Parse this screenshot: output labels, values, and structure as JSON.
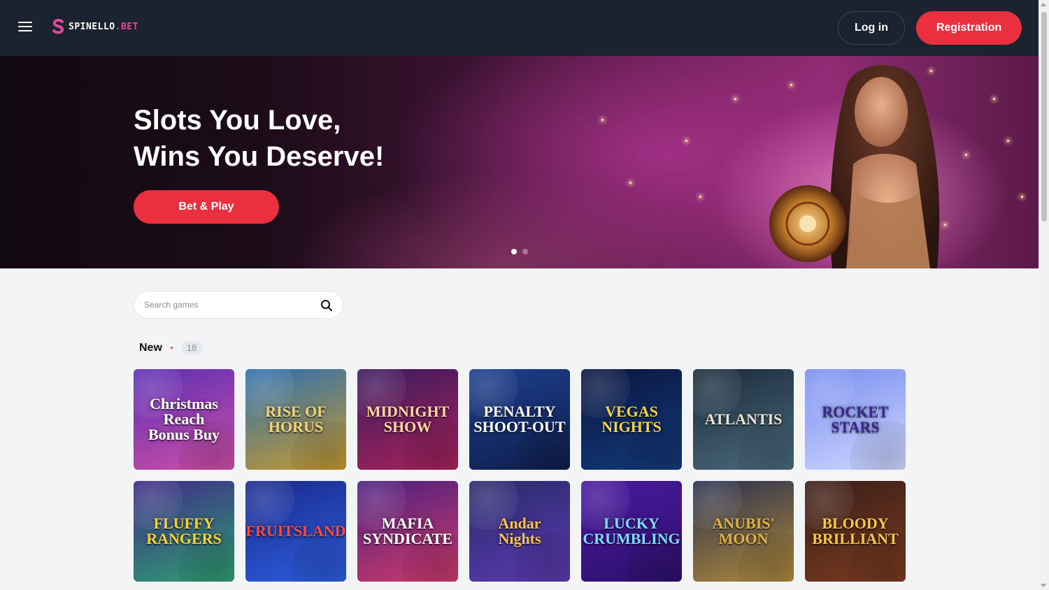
{
  "header": {
    "logo_main": "SPINELLO",
    "logo_suffix": ".BET",
    "login_label": "Log in",
    "register_label": "Registration",
    "menu_icon": "hamburger-menu-icon"
  },
  "hero": {
    "title_line1": "Slots You Love,",
    "title_line2": "Wins You Deserve!",
    "cta_label": "Bet & Play",
    "slides_total": 2,
    "active_slide": 1
  },
  "search": {
    "placeholder": "Search games",
    "icon": "search-icon"
  },
  "section": {
    "title": "New",
    "count": "18"
  },
  "games": [
    {
      "title": "Christmas\nReach\nBonus Buy",
      "colors": [
        "#5a2fb5",
        "#d04fa6"
      ],
      "text": "#ffffff"
    },
    {
      "title": "RISE OF\nHORUS",
      "colors": [
        "#2a6fb0",
        "#c89a2e"
      ],
      "text": "#f3d37a"
    },
    {
      "title": "MIDNIGHT\nSHOW",
      "colors": [
        "#3a1a5e",
        "#a8235a"
      ],
      "text": "#ffd6a0"
    },
    {
      "title": "PENALTY\nSHOOT-OUT",
      "colors": [
        "#1e3f8f",
        "#0d1d4a"
      ],
      "text": "#ffffff"
    },
    {
      "title": "VEGAS\nNIGHTS",
      "colors": [
        "#0a1640",
        "#123a7a"
      ],
      "text": "#f5d24a"
    },
    {
      "title": "ATLANTIS",
      "colors": [
        "#1a2b3a",
        "#4c6a7e"
      ],
      "text": "#e8e2d0"
    },
    {
      "title": "ROCKET\nSTARS",
      "colors": [
        "#7a8ef0",
        "#cfd8ff"
      ],
      "text": "#3a2a90"
    },
    {
      "title": "FLUFFY\nRANGERS",
      "colors": [
        "#3f2a8a",
        "#2f9f6f"
      ],
      "text": "#f7d13c"
    },
    {
      "title": "FRUITSLAND",
      "colors": [
        "#1a2a8a",
        "#2d5de0"
      ],
      "text": "#ff4a3a"
    },
    {
      "title": "MAFIA\nSYNDICATE",
      "colors": [
        "#4a2080",
        "#d03a6a"
      ],
      "text": "#ffffff"
    },
    {
      "title": "Andar\nNights",
      "colors": [
        "#2a2a6a",
        "#5a3ab0"
      ],
      "text": "#f2c14e"
    },
    {
      "title": "LUCKY\nCRUMBLING",
      "colors": [
        "#4a1aa0",
        "#2c0f6a"
      ],
      "text": "#7fd9ff"
    },
    {
      "title": "ANUBIS'\nMOON",
      "colors": [
        "#2a3050",
        "#b08a3a"
      ],
      "text": "#e0b040"
    },
    {
      "title": "BLOODY\nBRILLIANT",
      "colors": [
        "#3a1f18",
        "#7a3a20"
      ],
      "text": "#f3c74a"
    }
  ]
}
